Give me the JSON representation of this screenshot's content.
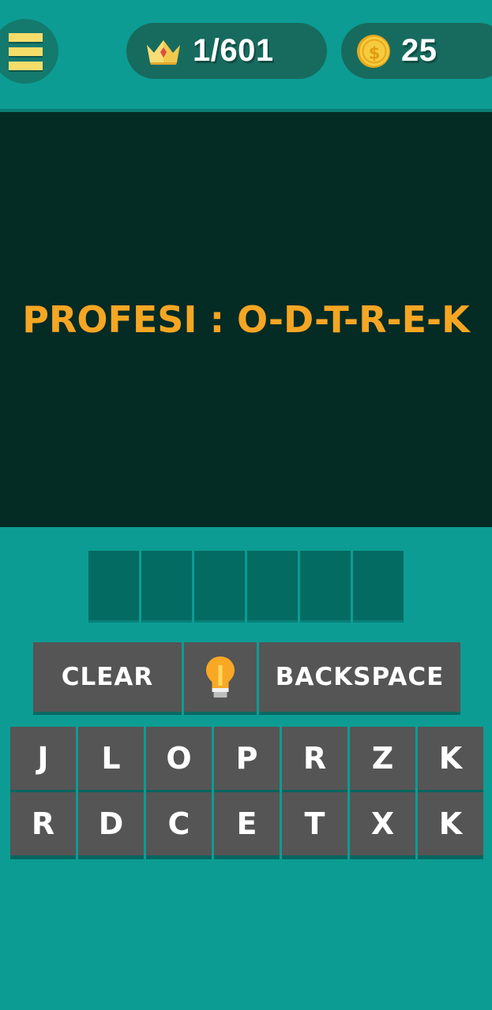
{
  "header": {
    "menu_icon": "hamburger-menu-icon",
    "level": {
      "icon": "crown-icon",
      "value": "1/601"
    },
    "coins": {
      "icon": "coin-icon",
      "value": "25"
    }
  },
  "puzzle": {
    "clue_text": "PROFESI : O-D-T-R-E-K"
  },
  "answer": {
    "slots": [
      "",
      "",
      "",
      "",
      "",
      ""
    ]
  },
  "actions": {
    "clear_label": "CLEAR",
    "hint_icon": "lightbulb-icon",
    "backspace_label": "BACKSPACE"
  },
  "keyboard": {
    "rows": [
      [
        "J",
        "L",
        "O",
        "P",
        "R",
        "Z",
        "K"
      ],
      [
        "R",
        "D",
        "C",
        "E",
        "T",
        "X",
        "K"
      ]
    ]
  },
  "colors": {
    "background_teal": "#0c9c93",
    "panel_dark": "#052b25",
    "clue_gold": "#f5a623",
    "key_gray": "#555555",
    "slot_teal": "#046b63",
    "pill_teal": "#176b5e"
  }
}
